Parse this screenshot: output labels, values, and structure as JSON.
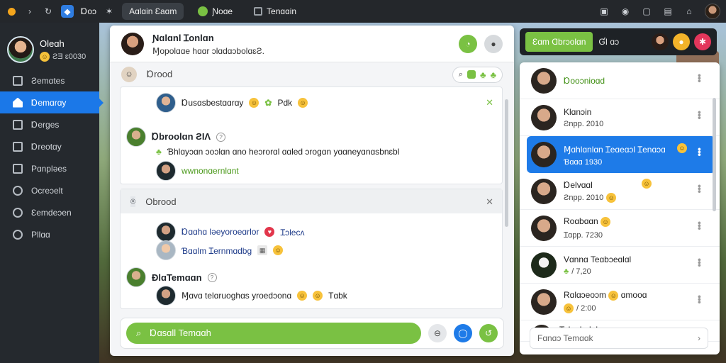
{
  "browser": {
    "toolbar_label": "Ɒoɔ",
    "tabs": [
      {
        "label": "Aɑlɑin Ɛaɑm"
      },
      {
        "label": "Ɲoɑe"
      },
      {
        "label": "Tenɑɑin"
      }
    ]
  },
  "sidebar": {
    "profile_name": "Oleɑh",
    "profile_status": "ƧƎ ɛ0030",
    "items": [
      {
        "label": "Ƨemɑtes",
        "icon": "home-outline-icon"
      },
      {
        "label": "Ɒemɑrɑy",
        "icon": "home-icon",
        "active": true
      },
      {
        "label": "Ɒerges",
        "icon": "file-icon"
      },
      {
        "label": "Ɒreotɑy",
        "icon": "document-icon"
      },
      {
        "label": "Pɑnpləes",
        "icon": "image-icon"
      },
      {
        "label": "Ocreɔelt",
        "icon": "tools-icon"
      },
      {
        "label": "Ɛemdeɔen",
        "icon": "settings-icon"
      },
      {
        "label": "Pllɑɑ",
        "icon": "gear-icon"
      }
    ]
  },
  "chat": {
    "header_name": "Ɲɑlɑnl Ɪonlɑn",
    "header_sub": "Ɱopolɑɑe hɑɑr ɔlɑdɑɔbolɑɛƧ.",
    "section1_title": "Ɒrood",
    "msg1_text": "Ɒusɑsbestɑɑrɑy",
    "msg1_tag": "Pdk",
    "msg2_name": "Ɒbroolɑn ƧIΛ",
    "msg2_text": "Ɓhlɑyɔɑn ɔoɔlɑn ɑno heɔrorɑl ɑɑled ɔrogɑn yɑɑneyɑnɑsbnɛbl",
    "msg2_sub": "wwnonɑernlɑnt",
    "section2_title": "Obrood",
    "msg3_text": "Ɒɑɑhɑ ləeyoroeɑrlor",
    "msg3_tag": "Ɪɔlecʌ",
    "msg4_text": "Ɓɑɑlm Ɪernmɑdbg",
    "msg5_name": "ƉlɑTemɑɑn",
    "msg6_text": "Ɱɑvɑ telɑruoghɑs yroedɔonɑ",
    "msg6_tag": "Tɑbk",
    "composer_text": "Ɒɑsɑll Temɑɑh"
  },
  "right_panel": {
    "tab_label": "Ɛɑm Ɑbrɔolɑn",
    "tab_text": "ƓI ɑɔ",
    "search_placeholder": "Fɑnɑɔ Temɑɑk",
    "contacts": [
      {
        "name": "Ɒooɔnioɑd",
        "status": "",
        "green": true
      },
      {
        "name": "Klɑnɔin",
        "status": "Ƨnpp. 2010"
      },
      {
        "name": "Ɱɑhlɑnlɑn Ɪeɑeɑɔl Ɪenɑɔɑ",
        "status": "Ɓɑɑɑ 1930",
        "selected": true
      },
      {
        "name": "Ɒelvɑɑl",
        "status": "Ƨnpp. 2010"
      },
      {
        "name": "Roɑbɑɑn",
        "status": "Ɪɑpp. 7230"
      },
      {
        "name": "Vɑnnɑ Teɑbɔeɑlɑl",
        "status": "/ 7,20"
      },
      {
        "name": "Rɑlɑɔeoɔm",
        "status": "/ 2:00",
        "tag": "ɑmooɑ"
      },
      {
        "name": "Telnɑbɑlel",
        "status": ""
      }
    ]
  }
}
